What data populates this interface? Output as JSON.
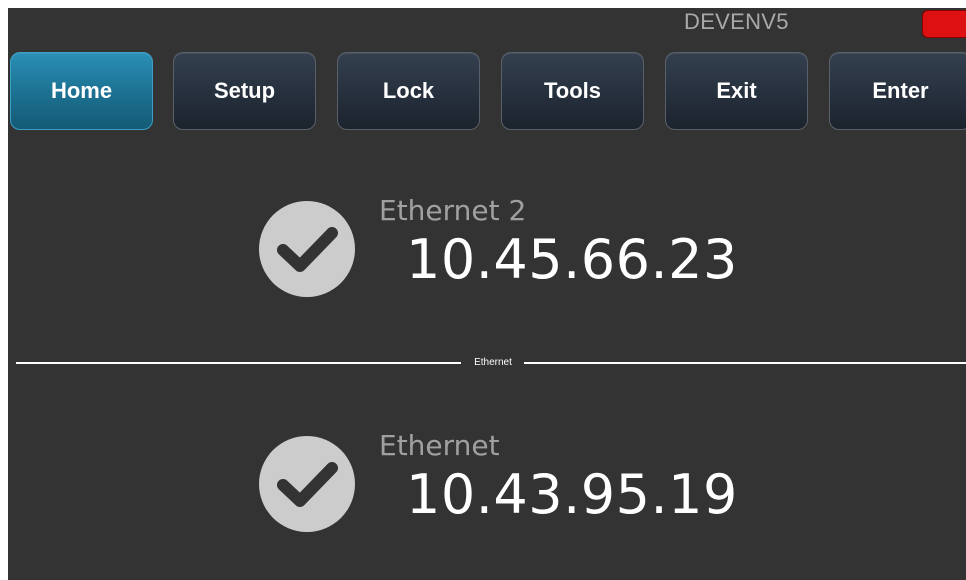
{
  "header": {
    "hostname": "DEVENV5",
    "status_color": "#dd1111"
  },
  "nav": {
    "buttons": [
      {
        "label": "Home",
        "active": true
      },
      {
        "label": "Setup",
        "active": false
      },
      {
        "label": "Lock",
        "active": false
      },
      {
        "label": "Tools",
        "active": false
      },
      {
        "label": "Exit",
        "active": false
      },
      {
        "label": "Enter",
        "active": false
      }
    ]
  },
  "connections": [
    {
      "name": "Ethernet 2",
      "ip": "10.45.66.23",
      "status_icon": "check-circle-icon"
    },
    {
      "name": "Ethernet",
      "ip": "10.43.95.19",
      "status_icon": "check-circle-icon"
    }
  ],
  "separator": {
    "label": "Ethernet"
  },
  "colors": {
    "background": "#333333",
    "active_button": "#1c7090",
    "button": "#26303d",
    "ip_text": "#ffffff",
    "name_text": "#a0a0a0",
    "icon": "#cccccc"
  }
}
